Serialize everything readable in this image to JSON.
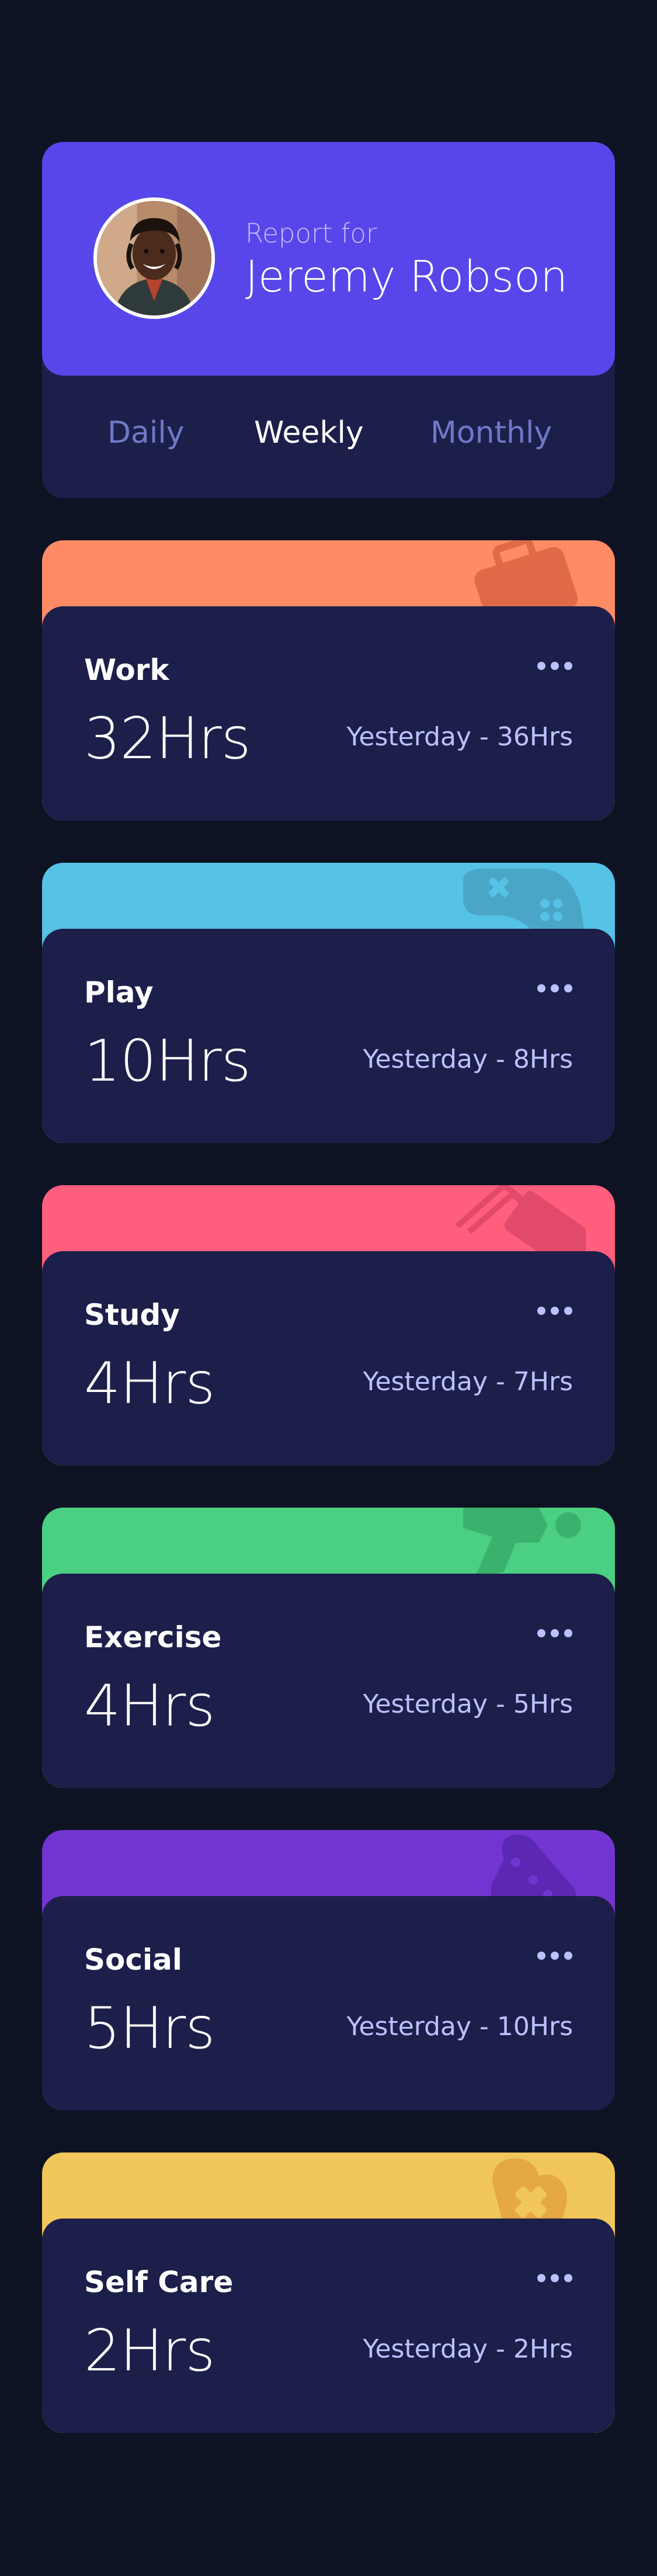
{
  "profile": {
    "report_for": "Report for",
    "name": "Jeremy Robson"
  },
  "tabs": [
    {
      "label": "Daily",
      "active": false
    },
    {
      "label": "Weekly",
      "active": true
    },
    {
      "label": "Monthly",
      "active": false
    }
  ],
  "activities": [
    {
      "title": "Work",
      "hours": "32Hrs",
      "previous": "Yesterday - 36Hrs",
      "color": "#ff8b64",
      "icon": "briefcase-icon"
    },
    {
      "title": "Play",
      "hours": "10Hrs",
      "previous": "Yesterday - 8Hrs",
      "color": "#55c2e6",
      "icon": "gamepad-icon"
    },
    {
      "title": "Study",
      "hours": "4Hrs",
      "previous": "Yesterday - 7Hrs",
      "color": "#ff5e7d",
      "icon": "book-icon"
    },
    {
      "title": "Exercise",
      "hours": "4Hrs",
      "previous": "Yesterday - 5Hrs",
      "color": "#4bcf82",
      "icon": "running-figure-icon"
    },
    {
      "title": "Social",
      "hours": "5Hrs",
      "previous": "Yesterday - 10Hrs",
      "color": "#7335d2",
      "icon": "social-bubble-icon"
    },
    {
      "title": "Self Care",
      "hours": "2Hrs",
      "previous": "Yesterday - 2Hrs",
      "color": "#f1c75b",
      "icon": "heart-icon"
    }
  ],
  "colors": {
    "background": "#0e1323",
    "card": "#1c1f4a",
    "profile": "#5747ea",
    "muted_text": "#bdc1ff",
    "inactive_tab": "#7078c9"
  }
}
